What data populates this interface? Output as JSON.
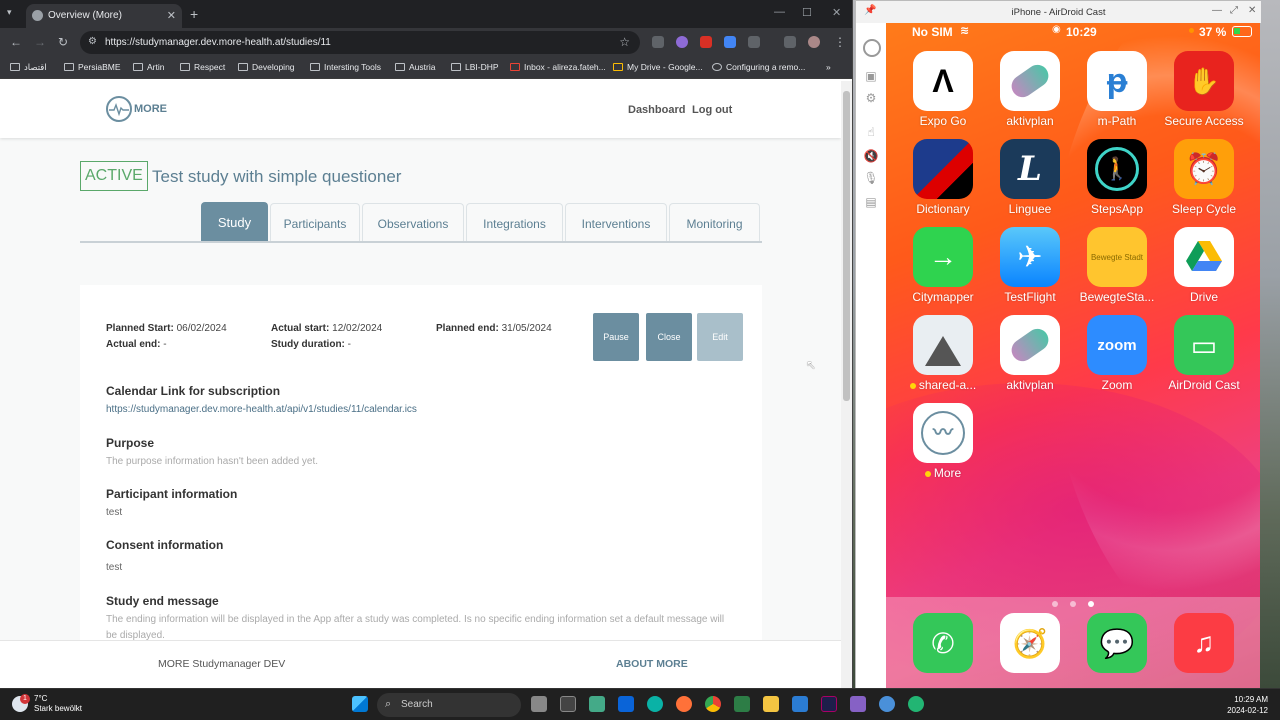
{
  "browser": {
    "tab_title": "Overview (More)",
    "url": "https://studymanager.dev.more-health.at/studies/11",
    "bookmarks": [
      "اقتصاد",
      "PersiaBME",
      "Artin",
      "Respect",
      "Developing",
      "Intersting Tools",
      "Austria",
      "LBI-DHP",
      "Inbox - alireza.fateh...",
      "My Drive - Google...",
      "Configuring a remo..."
    ]
  },
  "site": {
    "logo_text": "MORE",
    "nav": {
      "dashboard": "Dashboard",
      "logout": "Log out"
    },
    "status": "ACTIVE",
    "title": "Test study with simple questioner",
    "tabs": [
      "Study",
      "Participants",
      "Observations",
      "Integrations",
      "Interventions",
      "Monitoring"
    ],
    "meta": {
      "planned_start_label": "Planned Start:",
      "planned_start": "06/02/2024",
      "actual_start_label": "Actual start:",
      "actual_start": "12/02/2024",
      "planned_end_label": "Planned end:",
      "planned_end": "31/05/2024",
      "actual_end_label": "Actual end:",
      "actual_end": "-",
      "duration_label": "Study duration:",
      "duration": "-"
    },
    "actions": {
      "pause": "Pause",
      "close": "Close",
      "edit": "Edit"
    },
    "sections": {
      "calendar_h": "Calendar Link for subscription",
      "calendar_link": "https://studymanager.dev.more-health.at/api/v1/studies/11/calendar.ics",
      "purpose_h": "Purpose",
      "purpose_t": "The purpose information hasn't been added yet.",
      "participant_h": "Participant information",
      "participant_t": "test",
      "consent_h": "Consent information",
      "consent_t": "test",
      "end_h": "Study end message",
      "end_t": "The ending information will be displayed in the App after a study was completed. Is no specific ending information set a default message will be displayed."
    },
    "footer": {
      "left": "MORE Studymanager DEV",
      "right": "ABOUT MORE"
    }
  },
  "airdroid": {
    "title": "iPhone - AirDroid Cast",
    "status": {
      "carrier": "No SIM",
      "time": "10:29",
      "battery": "37 %"
    },
    "apps": [
      {
        "label": "Expo Go"
      },
      {
        "label": "aktivplan"
      },
      {
        "label": "m-Path"
      },
      {
        "label": "Secure Access"
      },
      {
        "label": "Dictionary"
      },
      {
        "label": "Linguee"
      },
      {
        "label": "StepsApp"
      },
      {
        "label": "Sleep Cycle"
      },
      {
        "label": "Citymapper"
      },
      {
        "label": "TestFlight"
      },
      {
        "label": "BewegteSta..."
      },
      {
        "label": "Drive"
      },
      {
        "label": "shared-a..."
      },
      {
        "label": "aktivplan"
      },
      {
        "label": "Zoom"
      },
      {
        "label": "AirDroid Cast"
      },
      {
        "label": "More"
      }
    ],
    "zoom_text": "zoom",
    "bewegte_text": "Bewegte Stadt"
  },
  "taskbar": {
    "temp": "7°C",
    "weather": "Stark bewölkt",
    "search": "Search",
    "time": "10:29 AM",
    "date": "2024-02-12",
    "badge": "1"
  }
}
